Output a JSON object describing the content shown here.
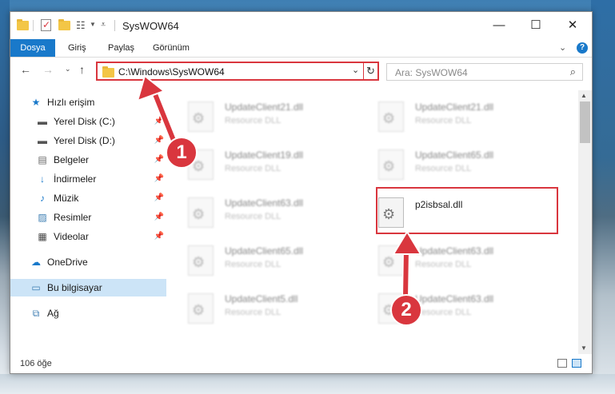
{
  "window": {
    "title": "SysWOW64",
    "controls": {
      "minimize": "—",
      "maximize": "☐",
      "close": "✕"
    }
  },
  "ribbon": {
    "tabs": [
      {
        "label": "Dosya",
        "active": true
      },
      {
        "label": "Giriş",
        "active": false
      },
      {
        "label": "Paylaş",
        "active": false
      },
      {
        "label": "Görünüm",
        "active": false
      }
    ],
    "expand_icon": "chevron-down-icon",
    "help_icon": "?"
  },
  "navigation": {
    "address": "C:\\Windows\\SysWOW64",
    "search_placeholder": "Ara: SysWOW64"
  },
  "sidebar": {
    "items": [
      {
        "label": "Hızlı erişim",
        "icon": "star-icon",
        "pinned": false
      },
      {
        "label": "Yerel Disk (C:)",
        "icon": "drive-icon",
        "pinned": true
      },
      {
        "label": "Yerel Disk (D:)",
        "icon": "drive-icon",
        "pinned": true
      },
      {
        "label": "Belgeler",
        "icon": "documents-icon",
        "pinned": true
      },
      {
        "label": "İndirmeler",
        "icon": "download-icon",
        "pinned": true
      },
      {
        "label": "Müzik",
        "icon": "music-icon",
        "pinned": true
      },
      {
        "label": "Resimler",
        "icon": "pictures-icon",
        "pinned": true
      },
      {
        "label": "Videolar",
        "icon": "video-icon",
        "pinned": true
      },
      {
        "label": "OneDrive",
        "icon": "cloud-icon",
        "pinned": false
      },
      {
        "label": "Bu bilgisayar",
        "icon": "computer-icon",
        "pinned": false,
        "selected": true
      },
      {
        "label": "Ağ",
        "icon": "network-icon",
        "pinned": false
      }
    ]
  },
  "files": [
    {
      "name": "UpdateClient21.dll",
      "type": "Resource DLL",
      "blurred": true
    },
    {
      "name": "UpdateClient21.dll",
      "type": "Resource DLL",
      "blurred": true
    },
    {
      "name": "UpdateClient19.dll",
      "type": "Resource DLL",
      "blurred": true
    },
    {
      "name": "UpdateClient65.dll",
      "type": "Resource DLL",
      "blurred": true
    },
    {
      "name": "UpdateClient63.dll",
      "type": "Resource DLL",
      "blurred": true
    },
    {
      "name": "p2isbsal.dll",
      "type": "",
      "blurred": false
    },
    {
      "name": "UpdateClient65.dll",
      "type": "Resource DLL",
      "blurred": true
    },
    {
      "name": "UpdateClient63.dll",
      "type": "Resource DLL",
      "blurred": true
    },
    {
      "name": "UpdateClient5.dll",
      "type": "Resource DLL",
      "blurred": true
    },
    {
      "name": "UpdateClient63.dll",
      "type": "Resource DLL",
      "blurred": true
    }
  ],
  "status": {
    "item_count": "106 öğe"
  },
  "annotations": {
    "step1": "1",
    "step2": "2",
    "color": "#d9363e"
  },
  "colors": {
    "accent": "#1979ca",
    "selection": "#cce4f7",
    "annotation": "#d9363e"
  }
}
